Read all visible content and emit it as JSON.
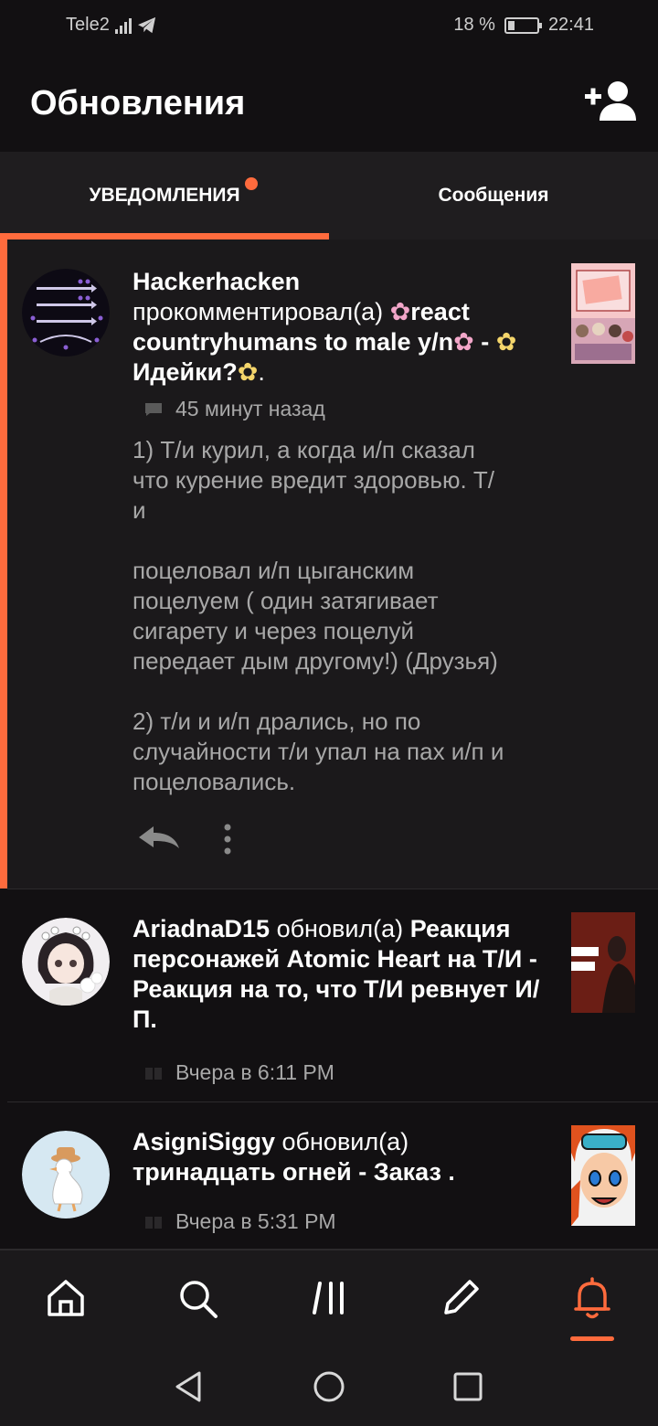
{
  "status_bar": {
    "carrier": "Tele2",
    "battery": "18 %",
    "time": "22:41"
  },
  "header": {
    "title": "Обновления",
    "add_friend_icon": "add-user-icon"
  },
  "tabs": [
    {
      "label": "УВЕДОМЛЕНИЯ",
      "active": true,
      "has_badge": true
    },
    {
      "label": "Сообщения",
      "active": false
    }
  ],
  "notifications": [
    {
      "user": "Hackerhacken",
      "action": "прокомментировал(а)",
      "title_line1": "react",
      "title_line2": "countryhumans to male y/n",
      "title_line3": " - ",
      "title_line4": "Идейки?",
      "time": "45 минут назад",
      "body": "1) Т/и курил, а когда и/п сказал\nчто курение вредит здоровью. Т/\nи\n\nпоцеловал и/п цыганским\nпоцелуем ( один затягивает\nсигарету и через поцелуй\nпередает дым другому!) (Друзья)\n\n2) т/и и и/п дрались, но по\nслучайности т/и упал на пах и/п и\nпоцеловались."
    },
    {
      "user": "AriadnaD15",
      "action": "обновил(а)",
      "title": "Реакция персонажей Atomic Heart на Т/И - Реакция на то, что Т/И ревнует И/П.",
      "time": "Вчера в 6:11 PM"
    },
    {
      "user": "AsigniSiggy",
      "action": "обновил(а)",
      "title": "тринадцать огней - Заказ .",
      "time": "Вчера в 5:31 PM"
    }
  ],
  "bottom_nav": [
    "home-icon",
    "search-icon",
    "library-icon",
    "write-icon",
    "bell-icon"
  ],
  "colors": {
    "accent": "#ff6b3d",
    "background": "#121012",
    "card": "#1b191b"
  }
}
